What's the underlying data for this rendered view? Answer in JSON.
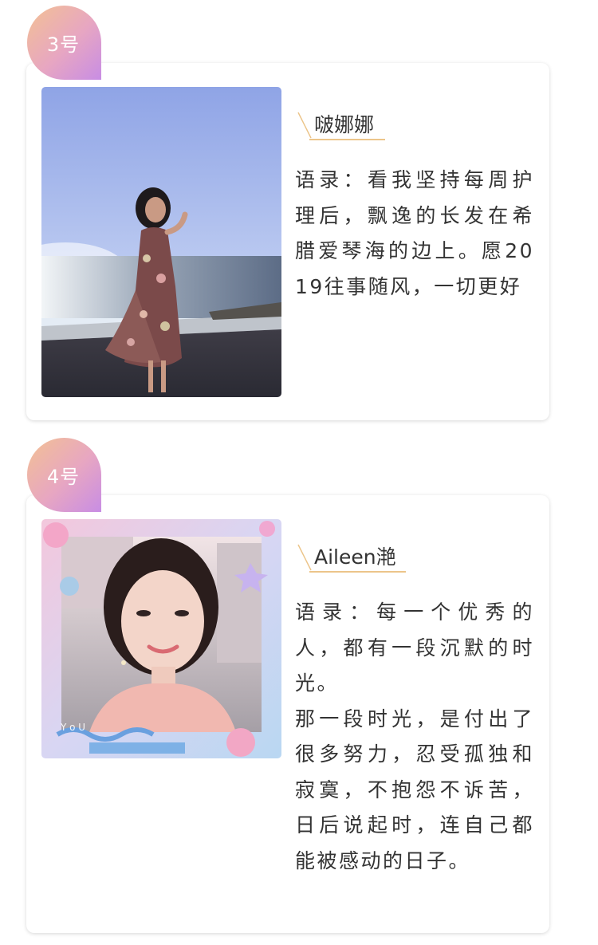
{
  "entries": [
    {
      "badge": "3号",
      "name": "啵娜娜",
      "quote": "语录：看我坚持每周护理后，飘逸的长发在希腊爱琴海的边上。愿2019往事随风，一切更好"
    },
    {
      "badge": "4号",
      "name": "Aileen滟",
      "quote": "语录：每一个优秀的人，都有一段沉默的时光。\n那一段时光，是付出了很多努力，忍受孤独和寂寞，不抱怨不诉苦，日后说起时，连自己都能被感动的日子。"
    }
  ],
  "colors": {
    "badge_gradient_start": "#f3c193",
    "badge_gradient_end": "#c88de4",
    "name_accent": "#ecc58a",
    "text": "#333333"
  }
}
